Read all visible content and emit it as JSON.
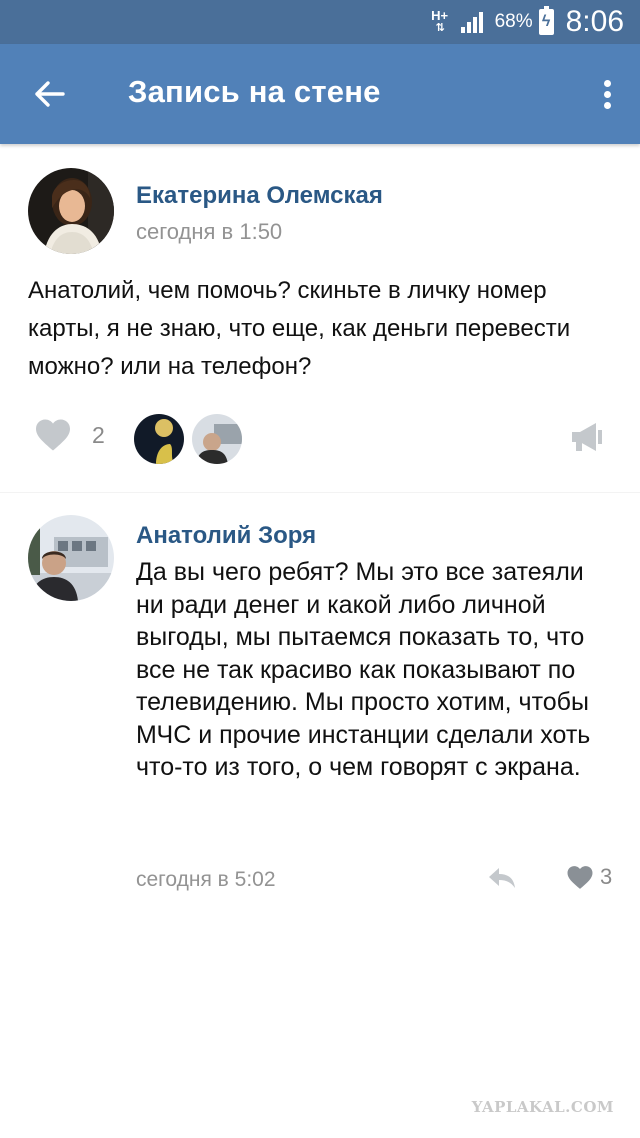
{
  "status_bar": {
    "network": "H+",
    "battery_percent": "68%",
    "time": "8:06"
  },
  "app_bar": {
    "title": "Запись на стене",
    "back_icon": "arrow-left-icon",
    "menu_icon": "more-vertical-icon"
  },
  "post": {
    "author": "Екатерина Олемская",
    "time": "сегодня в 1:50",
    "text": "Анатолий, чем помочь? скиньте в личку номер карты, я не знаю, что еще, как деньги перевести можно? или на телефон?",
    "likes": "2",
    "like_icon": "heart-icon",
    "share_icon": "megaphone-icon"
  },
  "comment": {
    "author": "Анатолий Зоря",
    "text": "Да вы чего ребят? Мы это все затеяли ни ради денег и какой либо личной выгоды, мы пытаемся показать то, что все не так красиво как показывают по телевидению. Мы просто хотим, чтобы МЧС и прочие инстанции сделали хоть что-то из того, о чем говорят с экрана.",
    "time": "сегодня в 5:02",
    "likes": "3",
    "reply_icon": "reply-icon",
    "like_icon": "heart-icon"
  },
  "watermark": "YAPLAKAL.COM",
  "colors": {
    "status_bar": "#4a6f99",
    "app_bar": "#5181b8",
    "author_name": "#2a5885",
    "meta_text": "#939393",
    "icon_gray": "#c4c8cc"
  }
}
